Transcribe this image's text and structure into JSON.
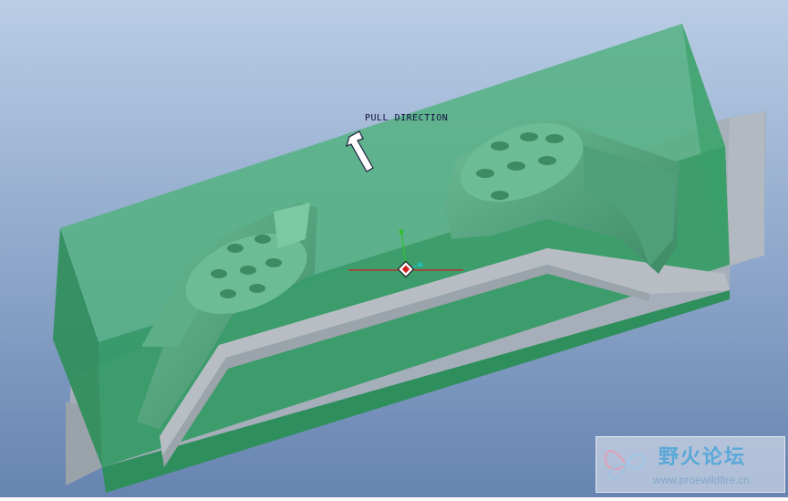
{
  "viewport": {
    "annotation": "PULL DIRECTION",
    "background_top": "#b7cce4",
    "background_bottom": "#6987b3",
    "mold_color": "#3fa872",
    "part_color": "#57a985",
    "workpiece_color": "#a9b1b8"
  },
  "watermark": {
    "title": "野火论坛",
    "url": "www.proewildfire.cn"
  }
}
